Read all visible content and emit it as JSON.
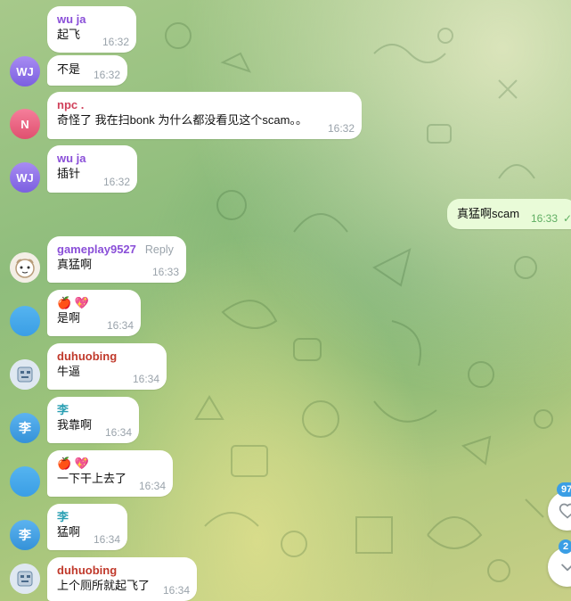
{
  "messages": [
    {
      "sender": "wu ja",
      "text": "起飞",
      "time": "16:32"
    },
    {
      "sender": "",
      "text": "不是",
      "time": "16:32",
      "avatar": "WJ"
    },
    {
      "sender": "npc .",
      "text": "奇怪了 我在扫bonk 为什么都没看见这个scam。。",
      "time": "16:32",
      "avatar": "N"
    },
    {
      "sender": "wu ja",
      "text": "插针",
      "time": "16:32",
      "avatar": "WJ"
    },
    {
      "sender": "gameplay9527",
      "reply_label": "Reply",
      "text": "真猛啊",
      "time": "16:33"
    },
    {
      "sender": "🍎 💖",
      "text": "是啊",
      "time": "16:34"
    },
    {
      "sender": "duhuobing",
      "text": "牛逼",
      "time": "16:34"
    },
    {
      "sender": "李",
      "text": "我靠啊",
      "time": "16:34",
      "avatar": "李"
    },
    {
      "sender": "🍎 💖",
      "text": "一下干上去了",
      "time": "16:34"
    },
    {
      "sender": "李",
      "text": "猛啊",
      "time": "16:34",
      "avatar": "李"
    },
    {
      "sender": "duhuobing",
      "text": "上个厕所就起飞了",
      "time": "16:34"
    }
  ],
  "outgoing": {
    "text": "真猛啊scam",
    "time": "16:33",
    "status": "✓"
  },
  "side": {
    "reactions_badge": "97",
    "scroll_badge": "2"
  },
  "colors": {
    "bubble_in": "#ffffff",
    "bubble_out": "#e9fbd8",
    "sender_purple": "#8a4fd8",
    "sender_red": "#c0392b",
    "sender_teal": "#2a9fb3"
  }
}
